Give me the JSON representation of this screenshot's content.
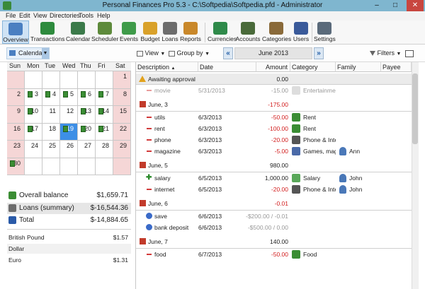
{
  "window": {
    "title": "Personal Finances Pro 5.3 - C:\\Softpedia\\Softpedia.pfd - Administrator",
    "minimize": "–",
    "maximize": "□",
    "close": "✕"
  },
  "menu": [
    "File",
    "Edit",
    "View",
    "Directories",
    "Tools",
    "Help"
  ],
  "ribbon": [
    {
      "label": "Overview",
      "icon": "overview-icon",
      "color": "#4a7fc1"
    },
    {
      "label": "Transactions",
      "icon": "transactions-icon",
      "color": "#2e8b3d"
    },
    {
      "label": "Calendar",
      "icon": "calendar-icon",
      "color": "#3b7a4a"
    },
    {
      "label": "Scheduler",
      "icon": "scheduler-icon",
      "color": "#5d8a3b"
    },
    {
      "label": "Events",
      "icon": "events-icon",
      "color": "#3f9b4a"
    },
    {
      "label": "Budget",
      "icon": "budget-icon",
      "color": "#d9a12a"
    },
    {
      "label": "Loans",
      "icon": "loans-icon",
      "color": "#6d6d6d"
    },
    {
      "label": "Reports",
      "icon": "reports-icon",
      "color": "#c9882a"
    },
    {
      "label": "Currencies",
      "icon": "currencies-icon",
      "color": "#2f8a4a"
    },
    {
      "label": "Accounts",
      "icon": "accounts-icon",
      "color": "#4a6a3a"
    },
    {
      "label": "Categories",
      "icon": "categories-icon",
      "color": "#8a6a3a"
    },
    {
      "label": "Users",
      "icon": "users-icon",
      "color": "#3a5a9a"
    },
    {
      "label": "Settings",
      "icon": "settings-icon",
      "color": "#5a6a7a"
    }
  ],
  "toolbar": {
    "calendar_label": "Calendar",
    "view_label": "View",
    "groupby_label": "Group by",
    "month": "June 2013",
    "filters_label": "Filters",
    "prev": "«",
    "next": "»"
  },
  "calendar": {
    "days": [
      "Sun",
      "Mon",
      "Tue",
      "Wed",
      "Thu",
      "Fri",
      "Sat"
    ],
    "weeks": [
      [
        "",
        "",
        "",
        "",
        "",
        "",
        "1"
      ],
      [
        "2",
        "3",
        "4",
        "5",
        "6",
        "7",
        "8"
      ],
      [
        "9",
        "10",
        "11",
        "12",
        "13",
        "14",
        "15"
      ],
      [
        "16",
        "17",
        "18",
        "19",
        "20",
        "21",
        "22"
      ],
      [
        "23",
        "24",
        "25",
        "26",
        "27",
        "28",
        "29"
      ],
      [
        "30",
        "",
        "",
        "",
        "",
        "",
        ""
      ]
    ],
    "selected": "19"
  },
  "summary": {
    "overall_label": "Overall balance",
    "overall_value": "$1,659.71",
    "loans_label": "Loans (summary)",
    "loans_value": "$-16,544.36",
    "total_label": "Total",
    "total_value": "$-14,884.65"
  },
  "currencies": [
    {
      "name": "British Pound",
      "value": "$1.57"
    },
    {
      "name": "Dollar",
      "value": ""
    },
    {
      "name": "Euro",
      "value": "$1.31"
    }
  ],
  "grid": {
    "headers": [
      "Description",
      "Date",
      "Amount",
      "Category",
      "Family member",
      "Payee"
    ],
    "sort_indicator": "▲",
    "rows": [
      {
        "kind": "awaiting",
        "desc": "Awaiting approval",
        "amount": "0.00"
      },
      {
        "kind": "item",
        "pending": true,
        "desc": "movie",
        "date": "5/31/2013",
        "amount": "-15.00",
        "cat": "Entertainmen",
        "member": "",
        "catColor": "#bcbcbc"
      },
      {
        "kind": "group",
        "desc": "June, 3",
        "amount": "-175.00"
      },
      {
        "kind": "item",
        "desc": "utils",
        "date": "6/3/2013",
        "amount": "-50.00",
        "cat": "Rent",
        "member": "",
        "catColor": "#3b8d34"
      },
      {
        "kind": "item",
        "desc": "rent",
        "date": "6/3/2013",
        "amount": "-100.00",
        "cat": "Rent",
        "member": "",
        "catColor": "#3b8d34"
      },
      {
        "kind": "item",
        "desc": "phone",
        "date": "6/3/2013",
        "amount": "-20.00",
        "cat": "Phone & Inte",
        "member": "",
        "catColor": "#555"
      },
      {
        "kind": "item",
        "desc": "magazine",
        "date": "6/3/2013",
        "amount": "-5.00",
        "cat": "Games, magz",
        "member": "Ann",
        "catColor": "#4a6aa8"
      },
      {
        "kind": "group",
        "desc": "June, 5",
        "amount": "980.00"
      },
      {
        "kind": "item",
        "income": true,
        "desc": "salary",
        "date": "6/5/2013",
        "amount": "1,000.00",
        "cat": "Salary",
        "member": "John",
        "catColor": "#5aa85a"
      },
      {
        "kind": "item",
        "desc": "internet",
        "date": "6/5/2013",
        "amount": "-20.00",
        "cat": "Phone & Inte",
        "member": "John",
        "catColor": "#555"
      },
      {
        "kind": "group",
        "desc": "June, 6",
        "amount": "-0.01"
      },
      {
        "kind": "item",
        "transfer": true,
        "desc": "save",
        "date": "6/6/2013",
        "amount": "-$200.00 / -0.01",
        "cat": "",
        "member": ""
      },
      {
        "kind": "item",
        "transfer": true,
        "desc": "bank deposit",
        "date": "6/6/2013",
        "amount": "-$500.00 / 0.00",
        "cat": "",
        "member": ""
      },
      {
        "kind": "group",
        "desc": "June, 7",
        "amount": "140.00"
      },
      {
        "kind": "item",
        "desc": "food",
        "date": "6/7/2013",
        "amount": "-50.00",
        "cat": "Food",
        "member": "",
        "catColor": "#3b8d34"
      }
    ]
  }
}
